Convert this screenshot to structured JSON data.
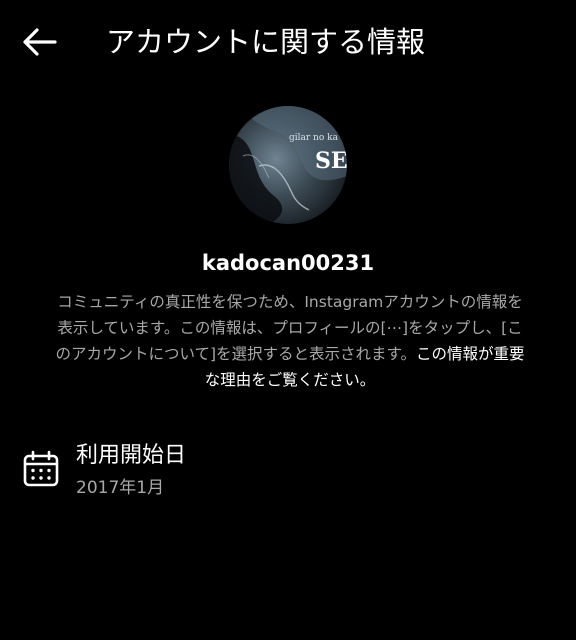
{
  "header": {
    "title": "アカウントに関する情報",
    "back_icon": "arrow-left-icon"
  },
  "profile": {
    "username": "kadocan00231",
    "avatar_text": "gilar no ka",
    "avatar_logo": "SE"
  },
  "description": {
    "text": "コミュニティの真正性を保つため、Instagramアカウントの情報を表示しています。この情報は、プロフィールの[⋯]をタップし、[このアカウントについて]を選択すると表示されます。",
    "link": "この情報が重要な理由をご覧ください。"
  },
  "date_joined": {
    "icon": "calendar-icon",
    "label": "利用開始日",
    "value": "2017年1月"
  }
}
